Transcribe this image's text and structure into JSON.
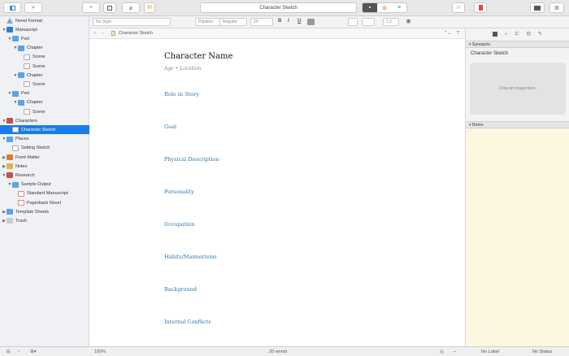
{
  "toolbar": {
    "title": "Character Sketch"
  },
  "binder": {
    "items": [
      {
        "label": "Novel Format",
        "icon": "triangle",
        "depth": 0,
        "arrow": ""
      },
      {
        "label": "Manuscript",
        "icon": "book",
        "depth": 0,
        "arrow": "▼"
      },
      {
        "label": "Part",
        "icon": "folder",
        "depth": 1,
        "arrow": "▼"
      },
      {
        "label": "Chapter",
        "icon": "folder",
        "depth": 2,
        "arrow": "▼"
      },
      {
        "label": "Scene",
        "icon": "doc",
        "depth": 3,
        "arrow": ""
      },
      {
        "label": "Scene",
        "icon": "doc",
        "depth": 3,
        "arrow": ""
      },
      {
        "label": "Chapter",
        "icon": "folder",
        "depth": 2,
        "arrow": "▼"
      },
      {
        "label": "Scene",
        "icon": "doc",
        "depth": 3,
        "arrow": ""
      },
      {
        "label": "Part",
        "icon": "folder",
        "depth": 1,
        "arrow": "▼"
      },
      {
        "label": "Chapter",
        "icon": "folder",
        "depth": 2,
        "arrow": "▼"
      },
      {
        "label": "Scene",
        "icon": "doc",
        "depth": 3,
        "arrow": ""
      },
      {
        "label": "Characters",
        "icon": "red",
        "depth": 0,
        "arrow": "▼"
      },
      {
        "label": "Character Sketch",
        "icon": "doc",
        "depth": 1,
        "arrow": "",
        "selected": true
      },
      {
        "label": "Places",
        "icon": "folder",
        "depth": 0,
        "arrow": "▼"
      },
      {
        "label": "Setting Sketch",
        "icon": "doc",
        "depth": 1,
        "arrow": ""
      },
      {
        "label": "Front Matter",
        "icon": "orange",
        "depth": 0,
        "arrow": "▶"
      },
      {
        "label": "Notes",
        "icon": "yellow",
        "depth": 0,
        "arrow": "▶"
      },
      {
        "label": "Research",
        "icon": "red",
        "depth": 0,
        "arrow": "▼"
      },
      {
        "label": "Sample Output",
        "icon": "folder",
        "depth": 1,
        "arrow": "▼"
      },
      {
        "label": "Standard Manuscript",
        "icon": "docpink",
        "depth": 2,
        "arrow": ""
      },
      {
        "label": "Paperback Novel",
        "icon": "docpink",
        "depth": 2,
        "arrow": ""
      },
      {
        "label": "Template Sheets",
        "icon": "folder",
        "depth": 0,
        "arrow": "▶"
      },
      {
        "label": "Trash",
        "icon": "trash",
        "depth": 0,
        "arrow": "▶"
      }
    ]
  },
  "formatbar": {
    "style": "No Style",
    "font": "Palatino",
    "weight": "Regular",
    "size": "20",
    "spacing": "1.2"
  },
  "editor_header": {
    "breadcrumb": "Character Sketch"
  },
  "document": {
    "title": "Character Name",
    "subtitle": "Age • Location",
    "headings": [
      "Role in Story",
      "Goal",
      "Physical Description",
      "Personality",
      "Occupation",
      "Habits/Mannerisms",
      "Background",
      "Internal Conflicts"
    ]
  },
  "inspector": {
    "synopsis_label": "Synopsis",
    "synopsis_title": "Character Sketch",
    "image_drop": "Drop an image here.",
    "notes_label": "Notes"
  },
  "footer": {
    "zoom": "100%",
    "word_count": "20 words",
    "label": "No Label",
    "status": "No Status"
  }
}
